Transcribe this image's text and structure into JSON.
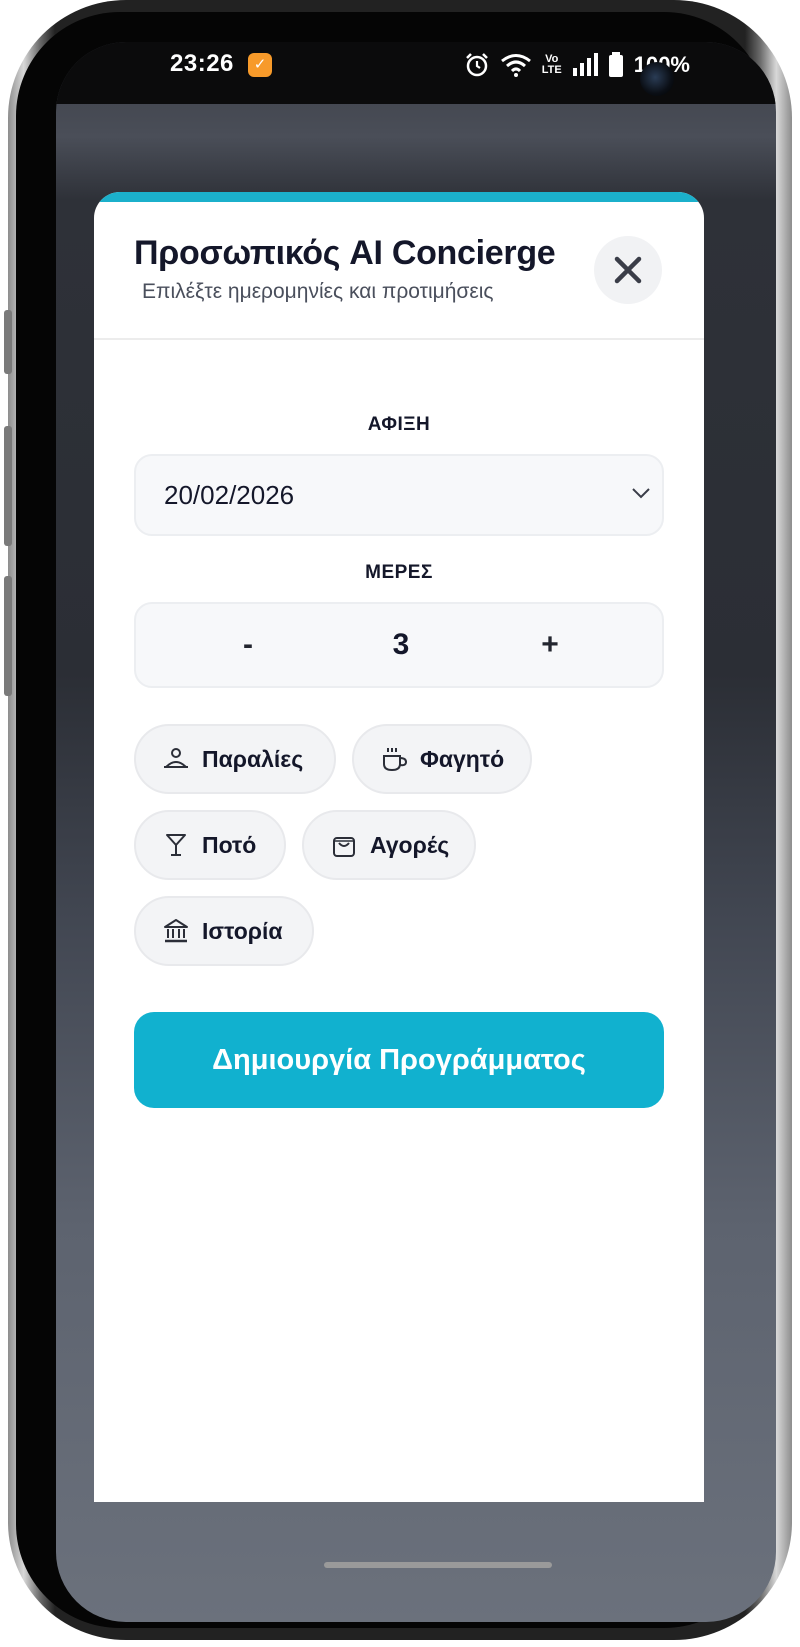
{
  "status_bar": {
    "time": "23:26",
    "battery": "100%",
    "icons": [
      "app-notification-icon",
      "alarm-icon",
      "wifi-icon",
      "volte-icon",
      "signal-icon",
      "battery-icon"
    ],
    "volte_top": "Vo",
    "volte_bottom": "LTE"
  },
  "modal": {
    "title": "Προσωπικός AI Concierge",
    "subtitle": "Επιλέξτε ημερομηνίες και προτιμήσεις",
    "accent_color": "#1bb0cb",
    "close_icon": "close-icon"
  },
  "arrival": {
    "label": "ΑΦΙΞΗ",
    "value": "20/02/2026",
    "icon": "chevron-down-icon"
  },
  "days": {
    "label": "ΜΕΡΕΣ",
    "minus_label": "-",
    "value": "3",
    "plus_label": "+"
  },
  "preferences": [
    {
      "label": "Παραλίες",
      "icon": "person-beach-icon"
    },
    {
      "label": "Φαγητό",
      "icon": "coffee-cup-icon"
    },
    {
      "label": "Ποτό",
      "icon": "cocktail-glass-icon"
    },
    {
      "label": "Αγορές",
      "icon": "shopping-bag-icon"
    },
    {
      "label": "Ιστορία",
      "icon": "museum-icon"
    }
  ],
  "generate_button": {
    "label": "Δημιουργία Προγράμματος",
    "color": "#11b1cf"
  }
}
